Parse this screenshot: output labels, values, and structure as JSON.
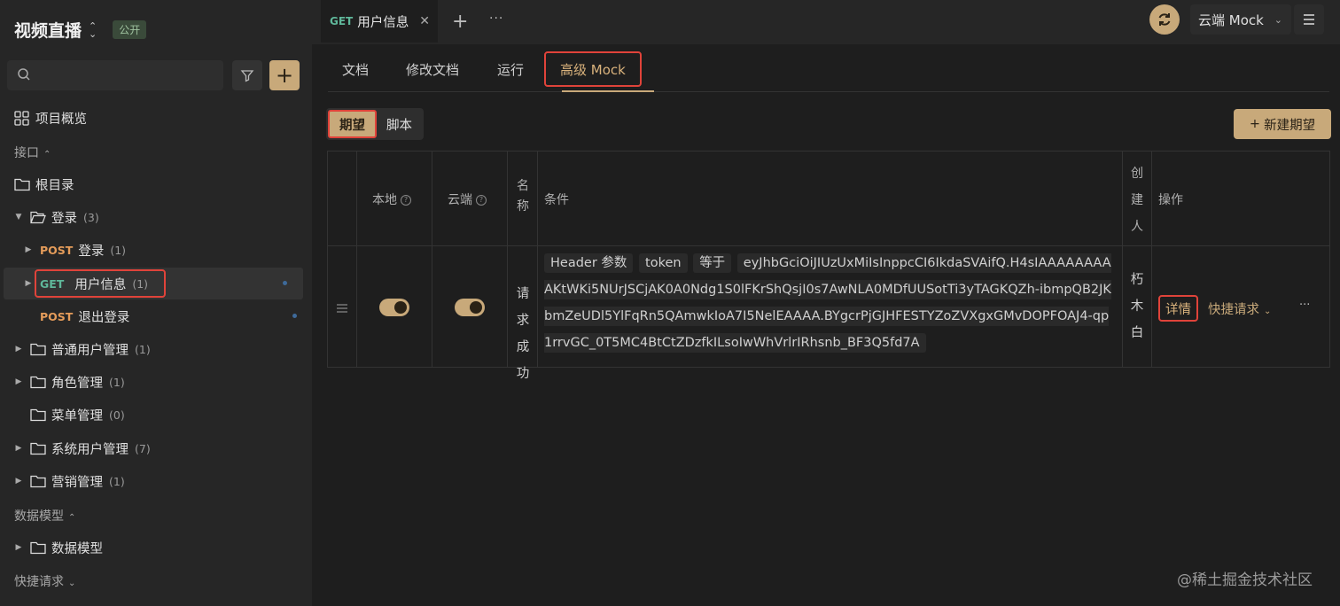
{
  "project": {
    "name": "视频直播",
    "visibility_badge": "公开"
  },
  "search": {
    "placeholder": ""
  },
  "sidebar": {
    "overview": "项目概览",
    "interfaces_section": "接口",
    "root": "根目录",
    "login_folder": {
      "label": "登录",
      "count": "(3)"
    },
    "login_items": [
      {
        "method": "POST",
        "label": "登录",
        "count": "(1)"
      },
      {
        "method": "GET",
        "label": "用户信息",
        "count": "(1)"
      },
      {
        "method": "POST",
        "label": "退出登录"
      }
    ],
    "folders": [
      {
        "label": "普通用户管理",
        "count": "(1)"
      },
      {
        "label": "角色管理",
        "count": "(1)"
      },
      {
        "label": "菜单管理",
        "count": "(0)"
      },
      {
        "label": "系统用户管理",
        "count": "(7)"
      },
      {
        "label": "营销管理",
        "count": "(1)"
      }
    ],
    "models_section": "数据模型",
    "models_folder": "数据模型",
    "quick_section": "快捷请求"
  },
  "topbar": {
    "tab_method": "GET",
    "tab_title": "用户信息",
    "env": "云端 Mock"
  },
  "subtabs": [
    "文档",
    "修改文档",
    "运行",
    "高级 Mock"
  ],
  "segment": [
    "期望",
    "脚本"
  ],
  "new_button": "新建期望",
  "table": {
    "headers": {
      "local": "本地",
      "cloud": "云端",
      "name": "名称",
      "condition": "条件",
      "creator": "创建人",
      "ops": "操作"
    },
    "row": {
      "local_on": true,
      "cloud_on": true,
      "name": "请求成功",
      "cond_part1": "Header 参数",
      "cond_part2": "token",
      "cond_part3": "等于",
      "cond_value": "eyJhbGciOiJIUzUxMiIsInppcCI6IkdaSVAifQ.H4sIAAAAAAAAAKtWKi5NUrJSCjAK0A0Ndg1S0lFKrShQsjI0s7AwNLA0MDfUUSotTi3yTAGKQZh-ibmpQB2JKbmZeUDl5YlFqRn5QAmwkIoA7I5NelEAAAA.BYgcrPjGJHFESTYZoZVXgxGMvDOPFOAJ4-qp1rrvGC_0T5MC4BtCtZDzfkILsoIwWhVrlrIRhsnb_BF3Q5fd7A",
      "creator": "朽木白",
      "detail": "详情",
      "quick": "快捷请求"
    }
  },
  "watermark": "@稀土掘金技术社区",
  "colors": {
    "accent": "#c8a97a",
    "get": "#5fb79a",
    "post": "#e59c5a",
    "highlight": "#e0433a"
  }
}
